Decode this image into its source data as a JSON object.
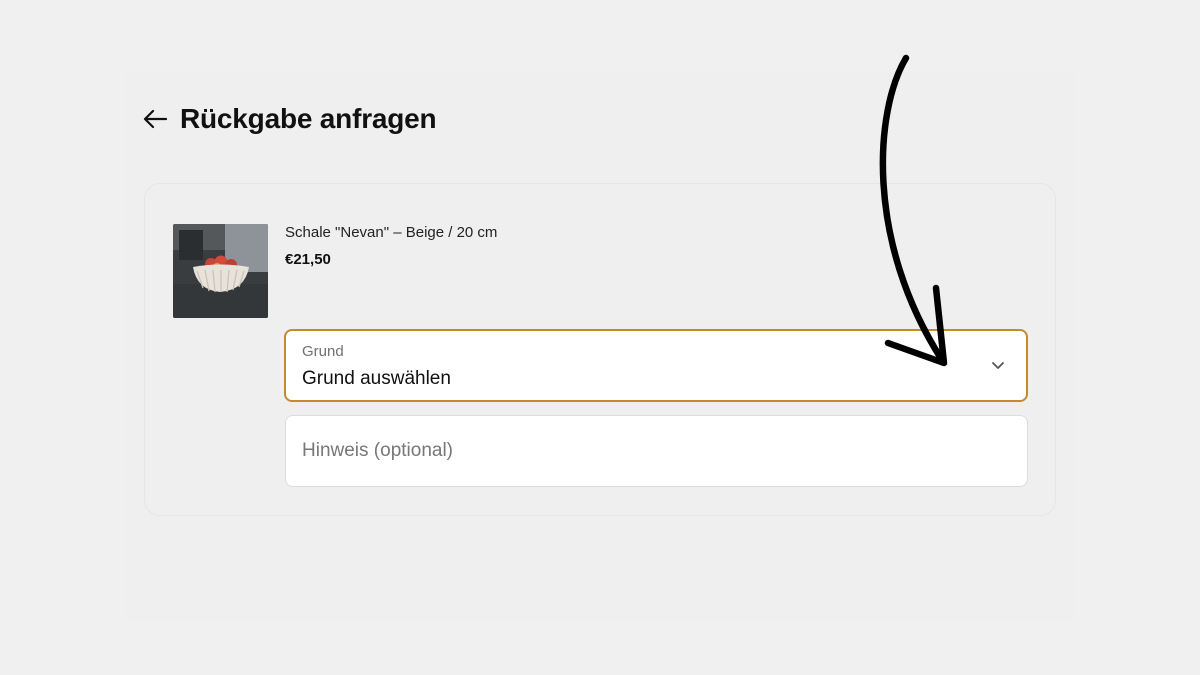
{
  "page": {
    "title": "Rückgabe anfragen",
    "back_icon": "arrow-left-icon"
  },
  "item": {
    "name": "Schale \"Nevan\" – Beige / 20 cm",
    "price": "€21,50",
    "image": "bowl-with-apples-photo"
  },
  "reason_select": {
    "label": "Grund",
    "value": "Grund auswählen",
    "icon": "chevron-down-icon"
  },
  "note_input": {
    "placeholder": "Hinweis (optional)",
    "value": ""
  },
  "annotation": {
    "icon": "curved-arrow-annotation"
  },
  "colors": {
    "background": "#f0f0f0",
    "accent_border": "#c58a2e",
    "field_background": "#ffffff"
  }
}
